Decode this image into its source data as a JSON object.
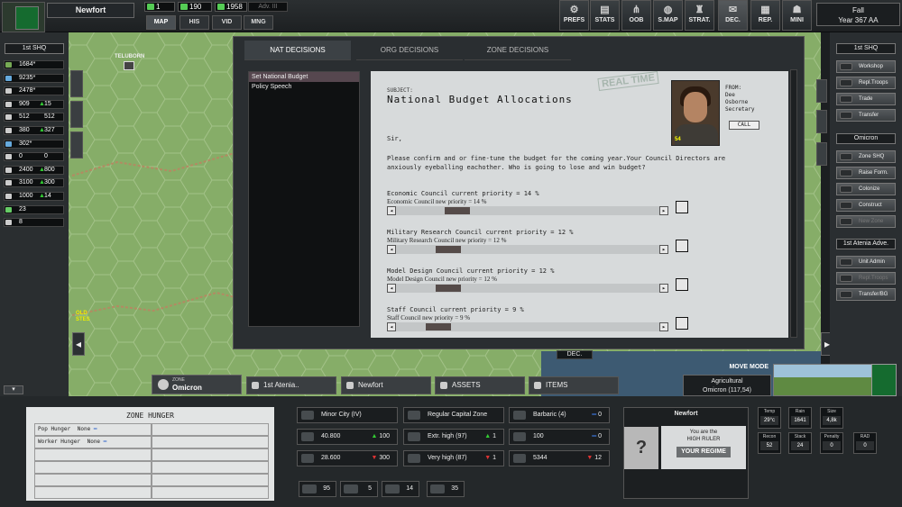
{
  "topbar": {
    "nation": "Newfort",
    "resources": [
      {
        "icon": "star-icon",
        "value": "1"
      },
      {
        "icon": "political-points-icon",
        "value": "190"
      },
      {
        "icon": "money-icon",
        "value": "1958"
      }
    ],
    "adv_label": "Adv. III",
    "view_tabs": [
      "MAP",
      "HIS",
      "VID",
      "MNG"
    ],
    "menu": [
      {
        "icon": "gear-icon",
        "label": "PREFS"
      },
      {
        "icon": "chart-icon",
        "label": "STATS"
      },
      {
        "icon": "oob-icon",
        "label": "OOB"
      },
      {
        "icon": "globe-icon",
        "label": "S.MAP"
      },
      {
        "icon": "strategy-icon",
        "label": "STRAT."
      },
      {
        "icon": "decision-icon",
        "label": "DEC."
      },
      {
        "icon": "report-icon",
        "label": "REP."
      },
      {
        "icon": "person-icon",
        "label": "MINI"
      }
    ],
    "date_line1": "Fall",
    "date_line2": "Year 367 AA"
  },
  "left": {
    "hq": "1st SHQ",
    "rows": [
      {
        "v1": "1684*",
        "v2": "",
        "dir": "none"
      },
      {
        "v1": "9235*",
        "v2": "",
        "dir": "none"
      },
      {
        "v1": "2478*",
        "v2": "",
        "dir": "none"
      },
      {
        "v1": "909",
        "v2": "15",
        "dir": "up"
      },
      {
        "v1": "512",
        "v2": "512",
        "dir": "none"
      },
      {
        "v1": "380",
        "v2": "327",
        "dir": "up"
      },
      {
        "v1": "302*",
        "v2": "",
        "dir": "none"
      },
      {
        "v1": "0",
        "v2": "0",
        "dir": "none"
      },
      {
        "v1": "2400",
        "v2": "800",
        "dir": "up"
      },
      {
        "v1": "3100",
        "v2": "300",
        "dir": "up"
      },
      {
        "v1": "1000",
        "v2": "14",
        "dir": "up"
      },
      {
        "v1": "23",
        "v2": "",
        "dir": "none"
      },
      {
        "v1": "8",
        "v2": "",
        "dir": "none"
      }
    ]
  },
  "map": {
    "town1": "TELUBORN",
    "town2": "OLD",
    "town2b": "STES"
  },
  "decisions": {
    "tabs": [
      "NAT DECISIONS",
      "ORG DECISIONS",
      "ZONE DECISIONS"
    ],
    "list": [
      "Set National Budget",
      "Policy Speech"
    ],
    "stamp": "REAL TIME",
    "subject_label": "SUBJECT:",
    "title": "National Budget Allocations",
    "from_label": "FROM:",
    "from_first": "Dee",
    "from_last": "Osborne",
    "from_role": "Secretary",
    "call": "CALL",
    "portrait_age": "54",
    "salutation": "Sir,",
    "body": "Please confirm and or fine-tune the budget for the coming year.Your Council Directors are anxiously eyeballing eachother. Who is going to lose and win budget?",
    "councils": [
      {
        "current": "Economic Council current priority = 14 %",
        "new": "Economic Council new priority = 14 %",
        "level": 0.2
      },
      {
        "current": "Military Research Council current priority = 12 %",
        "new": "Military Research Council new priority = 12 %",
        "level": 0.16
      },
      {
        "current": "Model Design Council current priority = 12 %",
        "new": "Model Design Council new priority = 12 %",
        "level": 0.16
      },
      {
        "current": "Staff Council current priority = 9 %",
        "new": "Staff Council new priority = 9 %",
        "level": 0.12
      }
    ],
    "arrow_left": "◂",
    "arrow_right": "▸",
    "dec_tag": "DEC."
  },
  "right": {
    "hq1": "1st SHQ",
    "hq1_buttons": [
      "Workshop",
      "Repl.Troops",
      "Trade",
      "Transfer"
    ],
    "hq2": "Omicron",
    "hq2_buttons": [
      "Zone SHQ",
      "Raise Form.",
      "Colonize",
      "Construct",
      "New Zone"
    ],
    "hq3": "1st Atenia Adve.",
    "hq3_buttons": [
      "Unit Admin",
      "Repl.Troops",
      "Transfer/BG"
    ]
  },
  "bottom": {
    "zone_label": "ZONE",
    "zone_name": "Omicron",
    "tabs": [
      "1st Atenia..",
      "Newfort",
      "ASSETS",
      "ITEMS"
    ],
    "zone_hunger_title": "ZONE HUNGER",
    "pop_hunger": "Pop Hunger",
    "pop_hunger_val": "None",
    "worker_hunger": "Worker Hunger",
    "worker_hunger_val": "None",
    "info": [
      {
        "label": "Minor City (IV)",
        "num": "",
        "g": "",
        "dir": "none"
      },
      {
        "label": "Regular Capital Zone",
        "num": "",
        "g": "",
        "dir": "none"
      },
      {
        "label": "Barbaric (4)",
        "num": "",
        "g": "0",
        "dir": "none"
      },
      {
        "label": "40.800",
        "num": "100",
        "g": "",
        "dir": "up"
      },
      {
        "label": "Extr. high (97)",
        "num": "1",
        "g": "",
        "dir": "up"
      },
      {
        "label": "100",
        "num": "",
        "g": "0",
        "dir": "none"
      },
      {
        "label": "28.600",
        "num": "300",
        "g": "",
        "dir": "dn"
      },
      {
        "label": "Very high (87)",
        "num": "1",
        "g": "",
        "dir": "dn"
      },
      {
        "label": "5344",
        "num": "12",
        "g": "",
        "dir": "dn"
      }
    ],
    "small": [
      "95",
      "5",
      "14",
      "35"
    ],
    "newfort_title": "Newfort",
    "ruler_line1": "You are the",
    "ruler_line2": "HIGH RULER",
    "your_regime": "YOUR REGIME",
    "unknown": "?",
    "move_mode": "MOVE MODE",
    "terrain": "Agricultural",
    "terrain_loc": "Omicron (117,54)",
    "stats": [
      {
        "label": "Temp",
        "value": "29°c"
      },
      {
        "label": "Rain",
        "value": "1641"
      },
      {
        "label": "Size",
        "value": "4,8k"
      },
      {
        "label": "Recon",
        "value": "52"
      },
      {
        "label": "Stack",
        "value": "24"
      },
      {
        "label": "Penalty",
        "value": "0"
      },
      {
        "label": "RAD",
        "value": "0"
      }
    ]
  }
}
